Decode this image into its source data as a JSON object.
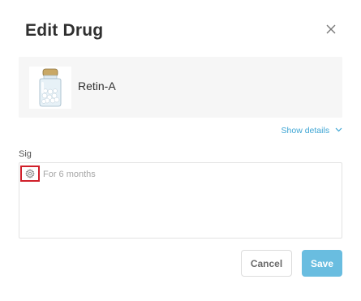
{
  "modal": {
    "title": "Edit Drug"
  },
  "drug": {
    "name": "Retin-A",
    "image_icon": "pill-bottle-icon"
  },
  "details_toggle": {
    "label": "Show details",
    "icon": "chevron-down-icon"
  },
  "sig": {
    "label": "Sig",
    "value": "For 6 months",
    "icon": "gear-icon"
  },
  "actions": {
    "cancel_label": "Cancel",
    "save_label": "Save"
  },
  "colors": {
    "accent": "#3da5d4",
    "save_bg": "#69bde0",
    "highlight": "#d0202a"
  }
}
